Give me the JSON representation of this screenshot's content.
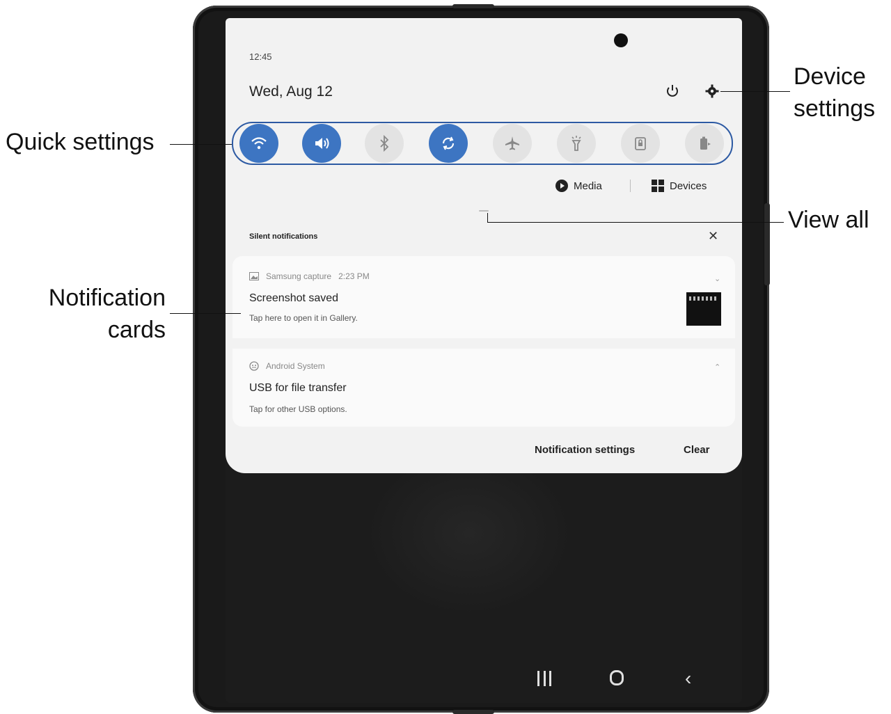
{
  "status": {
    "time": "12:45",
    "date": "Wed, Aug 12"
  },
  "quick_settings": [
    {
      "icon": "wifi-icon",
      "state": "on"
    },
    {
      "icon": "volume-icon",
      "state": "on"
    },
    {
      "icon": "bluetooth-icon",
      "state": "off"
    },
    {
      "icon": "auto-rotate-icon",
      "state": "on"
    },
    {
      "icon": "airplane-icon",
      "state": "off"
    },
    {
      "icon": "flashlight-icon",
      "state": "off"
    },
    {
      "icon": "lock-rotation-icon",
      "state": "off"
    },
    {
      "icon": "battery-share-icon",
      "state": "off"
    }
  ],
  "controls": {
    "media_label": "Media",
    "devices_label": "Devices"
  },
  "notifications": {
    "section_title": "Silent notifications",
    "cards": [
      {
        "app": "Samsung capture",
        "time": "2:23 PM",
        "title": "Screenshot saved",
        "body": "Tap here to open it in Gallery."
      },
      {
        "app": "Android System",
        "title": "USB for file transfer",
        "body": "Tap for other USB options."
      }
    ],
    "settings_label": "Notification settings",
    "clear_label": "Clear"
  },
  "callouts": {
    "quick_settings": "Quick settings",
    "notification_cards_line1": "Notification",
    "notification_cards_line2": "cards",
    "device_settings_line1": "Device",
    "device_settings_line2": "settings",
    "view_all": "View all"
  },
  "colors": {
    "accent": "#3d75c2",
    "outline": "#2d5aa3",
    "device": "#1a1a1a",
    "shade": "#f2f2f2"
  }
}
